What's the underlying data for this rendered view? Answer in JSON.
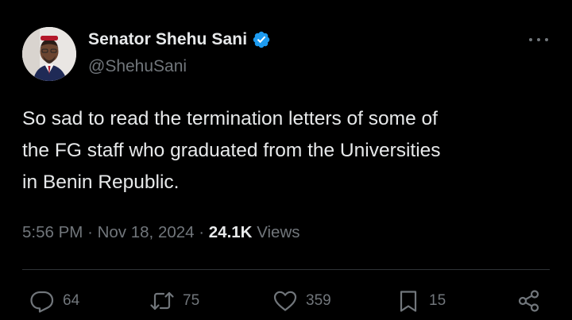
{
  "author": {
    "display_name": "Senator Shehu Sani",
    "handle": "@ShehuSani",
    "verified": true
  },
  "tweet": {
    "lines": [
      "So sad to read the termination letters of some of",
      "the FG staff who graduated from the Universities",
      "in Benin Republic."
    ]
  },
  "meta": {
    "time": "5:56 PM",
    "separator": "·",
    "date": "Nov 18, 2024",
    "views_count": "24.1K",
    "views_label": "Views"
  },
  "actions": {
    "replies": "64",
    "reposts": "75",
    "likes": "359",
    "bookmarks": "15"
  },
  "icons": {
    "avatar": "profile-photo",
    "verified": "verified-badge-icon",
    "more": "more-options-icon",
    "reply": "reply-icon",
    "repost": "repost-icon",
    "like": "heart-icon",
    "bookmark": "bookmark-icon",
    "share": "share-icon"
  },
  "colors": {
    "background": "#000000",
    "text": "#e7e9ea",
    "secondary": "#71767b",
    "verified": "#1d9bf0",
    "divider": "#2f3336"
  }
}
